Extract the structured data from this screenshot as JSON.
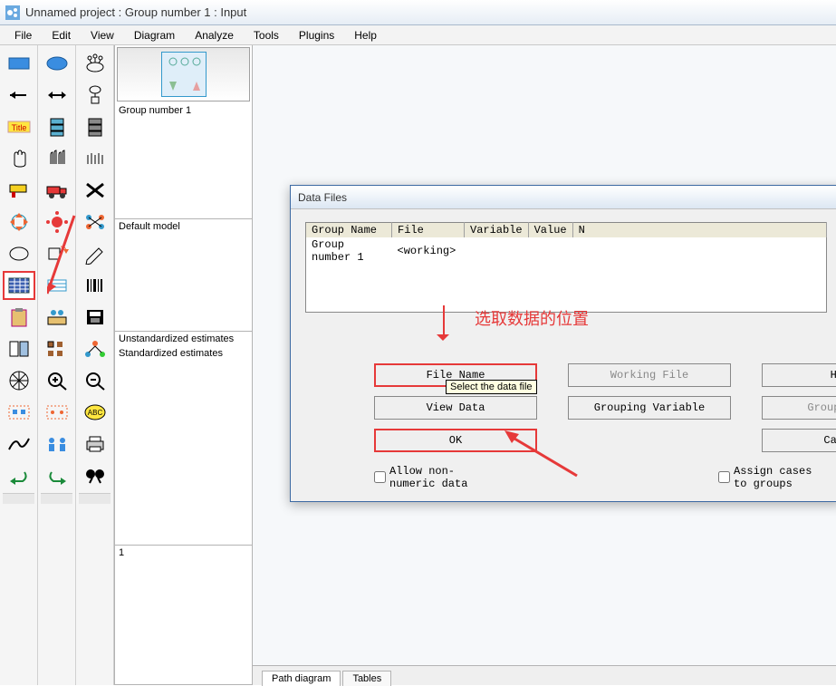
{
  "title": "Unnamed project : Group number 1 : Input",
  "menu": {
    "file": "File",
    "edit": "Edit",
    "view": "View",
    "diagram": "Diagram",
    "analyze": "Analyze",
    "tools": "Tools",
    "plugins": "Plugins",
    "help": "Help"
  },
  "panels": {
    "group": "Group number 1",
    "model": "Default model",
    "estimates": {
      "unstd": "Unstandardized estimates",
      "std": "Standardized estimates"
    },
    "message": "1"
  },
  "tabs": {
    "path_diagram": "Path diagram",
    "tables": "Tables"
  },
  "dialog": {
    "title": "Data Files",
    "columns": {
      "group": "Group Name",
      "file": "File",
      "variable": "Variable",
      "value": "Value",
      "n": "N"
    },
    "rows": [
      {
        "group": "Group number 1",
        "file": "<working>"
      }
    ],
    "buttons": {
      "file_name": "File Name",
      "working_file": "Working File",
      "help": "Help",
      "view_data": "View Data",
      "grouping_variable": "Grouping Variable",
      "group_value": "Group Value",
      "ok": "OK",
      "cancel": "Cancel"
    },
    "checks": {
      "allow_nonnum": "Allow non-numeric data",
      "assign_cases": "Assign cases to groups"
    },
    "tooltip": "Select the data file"
  },
  "annotation": {
    "label": "选取数据的位置"
  },
  "tools_col1": [
    "rectangle-tool",
    "arrow-left-tool",
    "title-tool",
    "hand-tool",
    "paint-tool",
    "rotate-tool",
    "ellipse-small-tool",
    "data-table-tool",
    "clipboard-tool",
    "properties-tool",
    "grid-tool",
    "select-all-tool",
    "curve-tool",
    "undo-tool"
  ],
  "tools_col2": [
    "ellipse-tool",
    "arrow-both-tool",
    "server-tool",
    "hand-pair-tool",
    "truck-tool",
    "sun-tool",
    "rotate-diagram-tool",
    "table-small-tool",
    "table-group-tool",
    "boxes-tool",
    "zoom-in-tool",
    "range-tool",
    "people-tool",
    "redo-tool"
  ],
  "tools_col3": [
    "latent-tool",
    "indicator-tool",
    "server-rack-tool",
    "hand-triple-tool",
    "delete-tool",
    "connector-tool",
    "pencil-tool",
    "barcode-tool",
    "save-tool",
    "network-tool",
    "zoom-out-tool",
    "abc-tool",
    "print-tool",
    "search-tool"
  ]
}
